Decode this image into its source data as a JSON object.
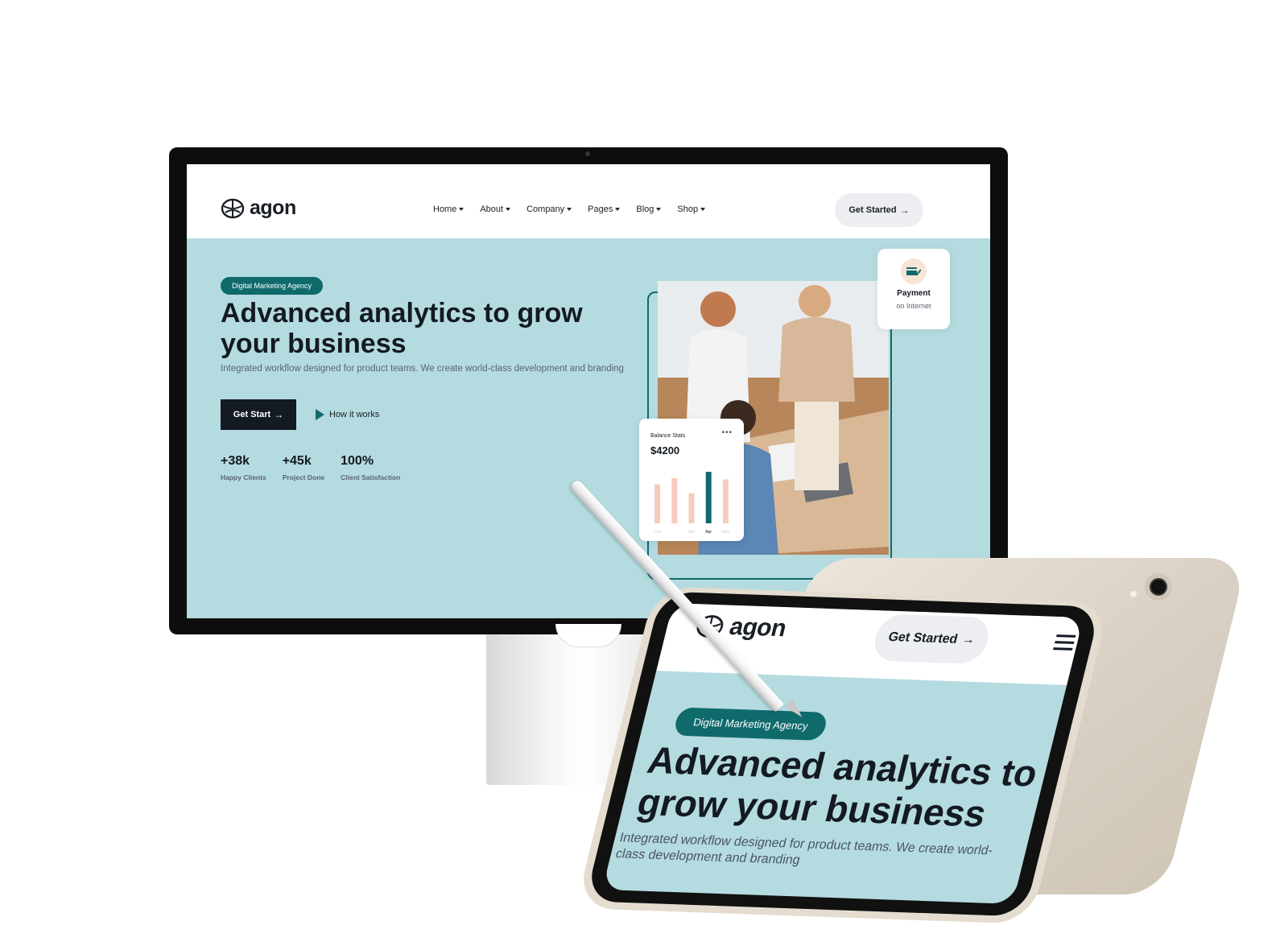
{
  "brand": {
    "name": "agon"
  },
  "nav": {
    "items": [
      {
        "label": "Home"
      },
      {
        "label": "About"
      },
      {
        "label": "Company"
      },
      {
        "label": "Pages"
      },
      {
        "label": "Blog"
      },
      {
        "label": "Shop"
      }
    ],
    "cta_label": "Get Started",
    "cta_arrow": "→"
  },
  "hero": {
    "badge": "Digital Marketing Agency",
    "title": "Advanced analytics to grow your business",
    "subtitle": "Integrated workflow designed for product teams. We create world-class development and branding",
    "primary_label": "Get Start",
    "primary_arrow": "→",
    "secondary_label": "How it works"
  },
  "stats": [
    {
      "value": "+38k",
      "label": "Happy Clients"
    },
    {
      "value": "+45k",
      "label": "Project Done"
    },
    {
      "value": "100%",
      "label": "Client Satisfaction"
    }
  ],
  "payment_card": {
    "title": "Payment",
    "subtitle": "on Internet"
  },
  "balance_card": {
    "title": "Balance Stats",
    "menu": "•••",
    "value": "$4200"
  },
  "chart_data": {
    "type": "bar",
    "categories": [
      "Feb",
      "",
      "Mar",
      "Apr",
      "May"
    ],
    "values": [
      0.62,
      0.72,
      0.48,
      0.82,
      0.7
    ],
    "highlight_index": 3,
    "colors": {
      "bar": "#f6cbbd",
      "highlight": "#0f6a6c"
    }
  },
  "tablet": {
    "brand": "agon",
    "cta_label": "Get Started",
    "cta_arrow": "→",
    "badge": "Digital Marketing Agency",
    "title": "Advanced analytics to grow your business",
    "subtitle": "Integrated workflow designed for product teams. We create world-class development and branding"
  },
  "colors": {
    "accent": "#0f6a6c",
    "hero_bg": "#b4dbe0",
    "dark": "#141a22",
    "payment_icon_bg": "#f6e4d7"
  }
}
